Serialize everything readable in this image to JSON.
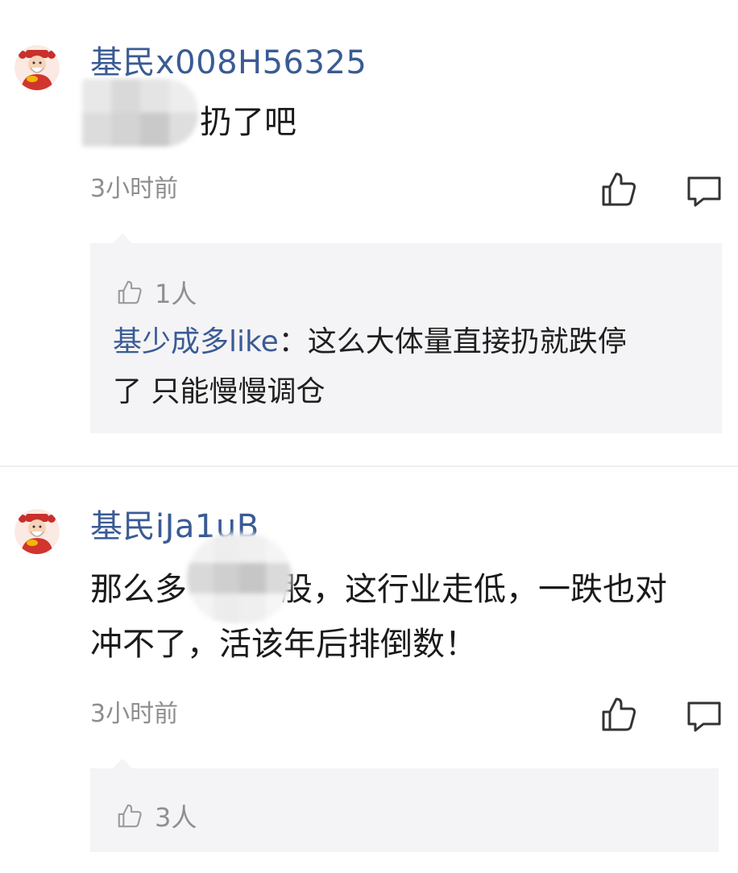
{
  "comments": [
    {
      "username": "基民x008H56325",
      "content_lines": [
        "扔了吧"
      ],
      "time": "3小时前",
      "reply_box": {
        "likes": "1人",
        "replies": [
          {
            "name": "基少成多like",
            "separator": "：",
            "text_line1": "这么大体量直接扔就跌停",
            "text_line2": "了 只能慢慢调仓"
          }
        ]
      }
    },
    {
      "username": "基民iJa1uB",
      "content_lines": [
        "那么多",
        "股，这行业走低，一跌也对",
        "冲不了，活该年后排倒数！"
      ],
      "time": "3小时前",
      "reply_box": {
        "likes": "3人"
      }
    }
  ],
  "icons": {
    "like": "thumbs-up-icon",
    "comment": "speech-bubble-icon",
    "avatar": "caishen-avatar-icon"
  },
  "colors": {
    "username": "#3a5b94",
    "time": "#8e8e8e",
    "reply_background": "#f4f4f6"
  }
}
